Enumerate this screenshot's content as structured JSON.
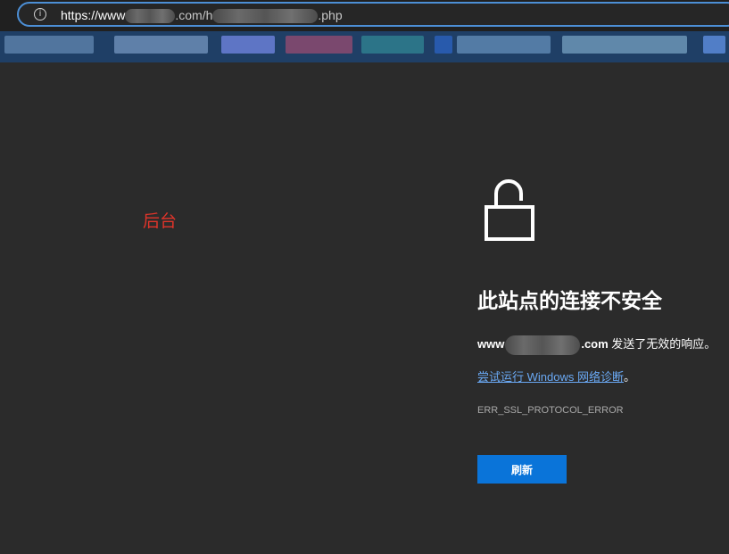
{
  "address_bar": {
    "url_prefix": "https://www",
    "url_mid": ".com/h",
    "url_suffix": ".php"
  },
  "page_note": "后台",
  "error_page": {
    "title": "此站点的连接不安全",
    "host_prefix": "www",
    "host_suffix": ".com",
    "message": " 发送了无效的响应。",
    "diagnose_link": "尝试运行 Windows 网络诊断",
    "diagnose_period": "。",
    "error_code": "ERR_SSL_PROTOCOL_ERROR",
    "refresh_label": "刷新"
  },
  "icons": {
    "site_info": "info-icon",
    "lock": "unlocked-padlock-icon"
  },
  "colors": {
    "background": "#2b2b2b",
    "accent": "#0a74d9",
    "link": "#6aa9f4",
    "note": "#e0342a"
  }
}
